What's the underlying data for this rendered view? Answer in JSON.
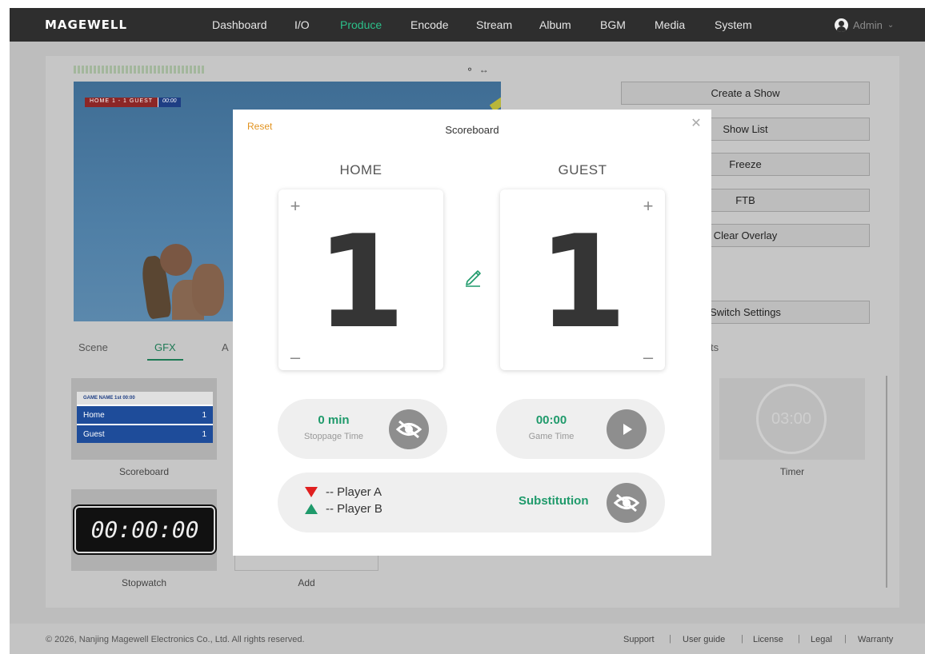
{
  "app": {
    "logo": "MAGEWELL"
  },
  "nav": {
    "items": [
      "Dashboard",
      "I/O",
      "Produce",
      "Encode",
      "Stream",
      "Album",
      "BGM",
      "Media",
      "System"
    ],
    "active": "Produce",
    "user": "Admin"
  },
  "background": {
    "preview_mini_score": {
      "left": "HOME 1 - 1 GUEST",
      "right": "00:00"
    },
    "right_buttons": [
      "Create a Show",
      "Show List",
      "Freeze",
      "FTB",
      "Clear Overlay",
      "Switch Settings"
    ],
    "tabs": [
      "Scene",
      "GFX",
      "A"
    ],
    "active_tab": "GFX",
    "tab_right_partial": "ts",
    "thumbnails": {
      "scoreboard": {
        "label": "Scoreboard",
        "header": "GAME NAME  1st  00:00",
        "rows": [
          {
            "team": "Home",
            "score": "1"
          },
          {
            "team": "Guest",
            "score": "1"
          }
        ]
      },
      "stopwatch": {
        "label": "Stopwatch",
        "display": "00:00:00"
      },
      "add": {
        "label": "Add"
      },
      "timer": {
        "label": "Timer",
        "display": "03:00"
      }
    }
  },
  "modal": {
    "reset_label": "Reset",
    "title": "Scoreboard",
    "home": {
      "name": "HOME",
      "score": "1"
    },
    "guest": {
      "name": "GUEST",
      "score": "1"
    },
    "stoppage": {
      "value": "0 min",
      "label": "Stoppage Time"
    },
    "game_time": {
      "value": "00:00",
      "label": "Game Time"
    },
    "substitution": {
      "player_out": "-- Player A",
      "player_in": "-- Player B",
      "label": "Substitution"
    },
    "colors": {
      "accent": "#1f9a6b",
      "reset": "#e2931f",
      "out": "#e02020"
    }
  },
  "footer": {
    "copyright": "© 2026, Nanjing Magewell Electronics Co., Ltd. All rights reserved.",
    "links": [
      "Support",
      "User guide",
      "License",
      "Legal",
      "Warranty"
    ]
  }
}
